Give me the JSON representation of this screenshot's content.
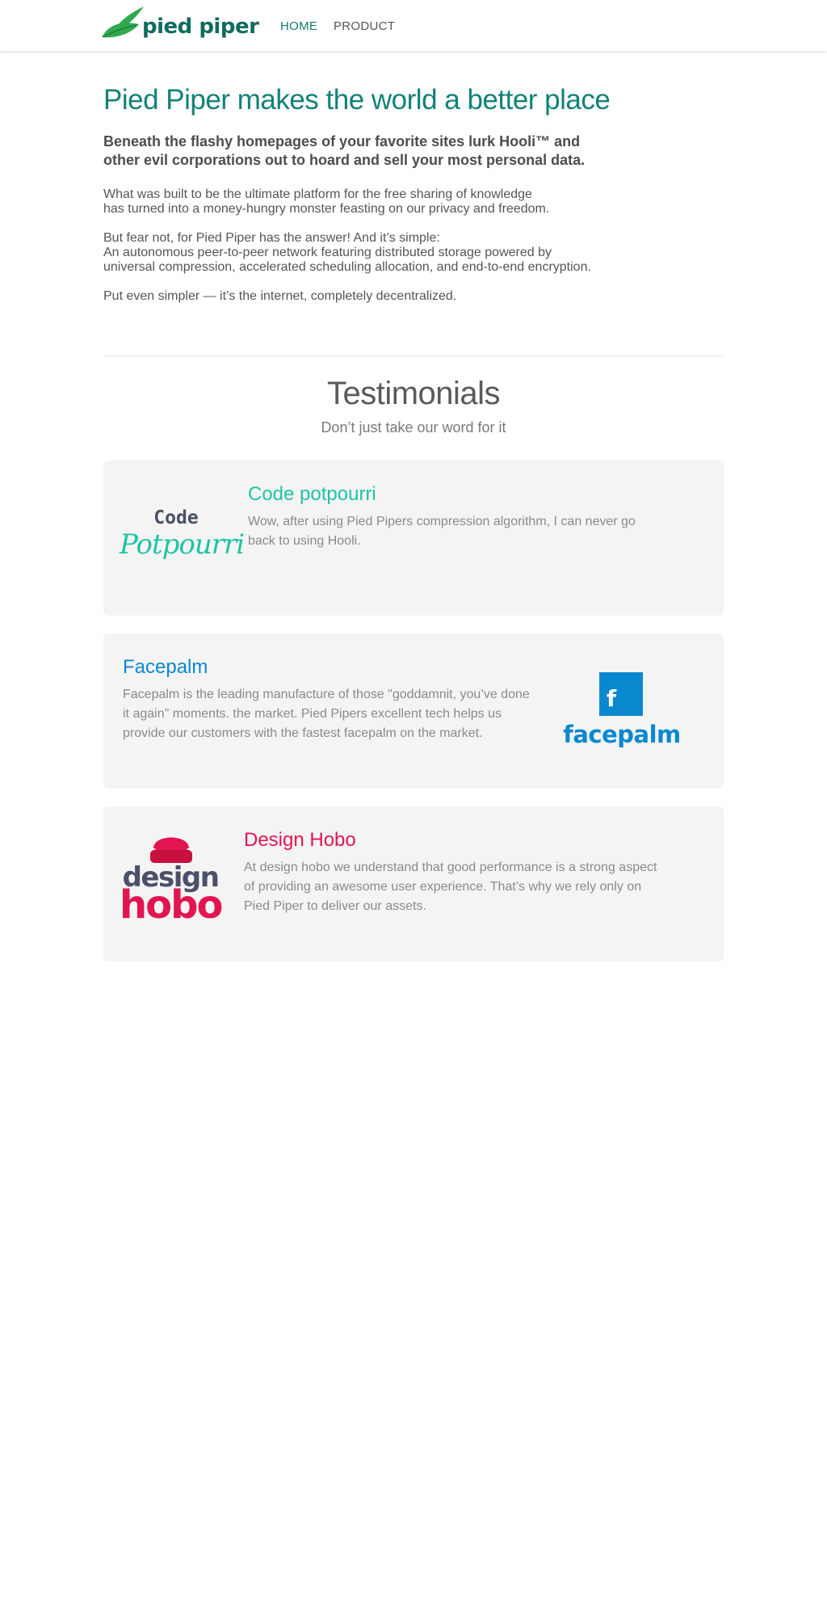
{
  "header": {
    "logo_text": "pied piper",
    "nav": [
      {
        "label": "HOME",
        "active": true
      },
      {
        "label": "PRODUCT",
        "active": false
      }
    ]
  },
  "hero": {
    "title": "Pied Piper makes the world a better place",
    "subtitle": "Beneath the flashy homepages of your favorite sites lurk Hooli™ and other evil corporations out to hoard and sell your most personal data.",
    "paragraphs": [
      "What was built to be the ultimate platform for the free sharing of knowledge has turned into a money-hungry monster feasting on our privacy and freedom.",
      "But fear not, for Pied Piper has the answer! And it’s simple: An autonomous peer-to-peer network featuring distributed storage powered by universal compression, accelerated scheduling allocation, and end-to-end encryption.",
      "Put even simpler — it’s the internet, completely decentralized."
    ],
    "paragraph_lines": [
      [
        "What was built to be the ultimate platform for the free sharing of knowledge",
        "has turned into a money-hungry monster feasting on our privacy and freedom."
      ],
      [
        "But fear not, for Pied Piper has the answer! And it’s simple:",
        "An autonomous peer-to-peer network featuring distributed storage powered by",
        "universal compression, accelerated scheduling allocation, and end-to-end encryption."
      ],
      [
        "Put even simpler — it’s the internet, completely decentralized."
      ]
    ]
  },
  "testimonials": {
    "heading": "Testimonials",
    "subheading": "Don’t just take our word for it",
    "items": [
      {
        "name": "Code potpourri",
        "text": "Wow, after using Pied Pipers compression algorithm, I can never go back to using Hooli.",
        "logo_top": "Code",
        "logo_bottom": "Potpourri",
        "color": "#1fc4a4"
      },
      {
        "name": "Facepalm",
        "text": "Facepalm is the leading manufacture of those \"goddamnit, you’ve done it again\" moments. the market. Pied Pipers excellent tech helps us provide our customers with the fastest facepalm on the market.",
        "logo_letter": "f",
        "logo_word": "facepalm",
        "color": "#0a88cf"
      },
      {
        "name": "Design Hobo",
        "text": "At design hobo we understand that good performance is a strong aspect of providing an awesome user experience. That’s why we rely only on Pied Piper to deliver our assets.",
        "logo_top": "design",
        "logo_bottom": "hobo",
        "color": "#e21550"
      }
    ]
  },
  "colors": {
    "brand_green": "#0f6b5d",
    "title_teal": "#128277",
    "card_bg": "#f4f4f4"
  }
}
